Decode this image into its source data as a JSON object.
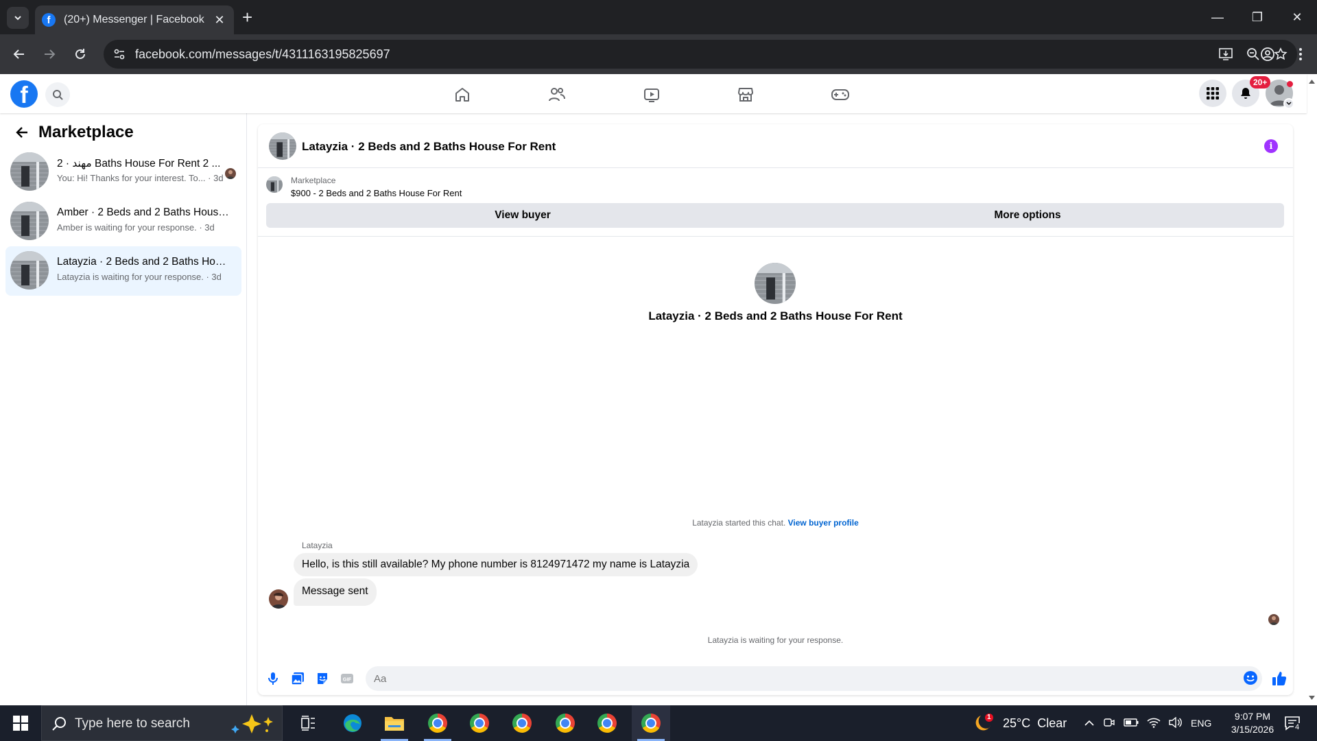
{
  "browser": {
    "tab_title": "(20+) Messenger | Facebook",
    "url": "facebook.com/messages/t/4311163195825697"
  },
  "fb": {
    "notif_badge": "20+",
    "logo_letter": "f"
  },
  "left": {
    "title": "Marketplace",
    "conversations": [
      {
        "name": "مهند · 2 Baths House For Rent 2 ...",
        "sub": "You: Hi! Thanks for your interest. To... · 3d"
      },
      {
        "name": "Amber · 2 Beds and 2 Baths House...",
        "sub": "Amber is waiting for your response. · 3d"
      },
      {
        "name": "Latayzia · 2 Beds and 2 Baths Hous...",
        "sub": "Latayzia is waiting for your response. · 3d"
      }
    ]
  },
  "chat": {
    "title": "Latayzia · 2 Beds and 2 Baths House For Rent",
    "marketplace_label": "Marketplace",
    "listing": "$900 - 2 Beds and 2 Baths House For Rent",
    "view_buyer": "View buyer",
    "more_options": "More options",
    "center_title": "Latayzia · 2 Beds and 2 Baths House For Rent",
    "started_text": "Latayzia started this chat.",
    "view_buyer_profile": "View buyer profile",
    "sender": "Latayzia",
    "messages": [
      "Hello, is this still available? My phone number is 8124971472 my name is Latayzia",
      "Message sent"
    ],
    "waiting": "Latayzia is waiting for your response.",
    "input_placeholder": "Aa"
  },
  "taskbar": {
    "search_placeholder": "Type here to search",
    "weather": "25°C  Clear",
    "weather_badge": "1",
    "lang": "ENG",
    "time": "9:07 PM",
    "date": "3/15/2026",
    "notif_count": "4"
  }
}
